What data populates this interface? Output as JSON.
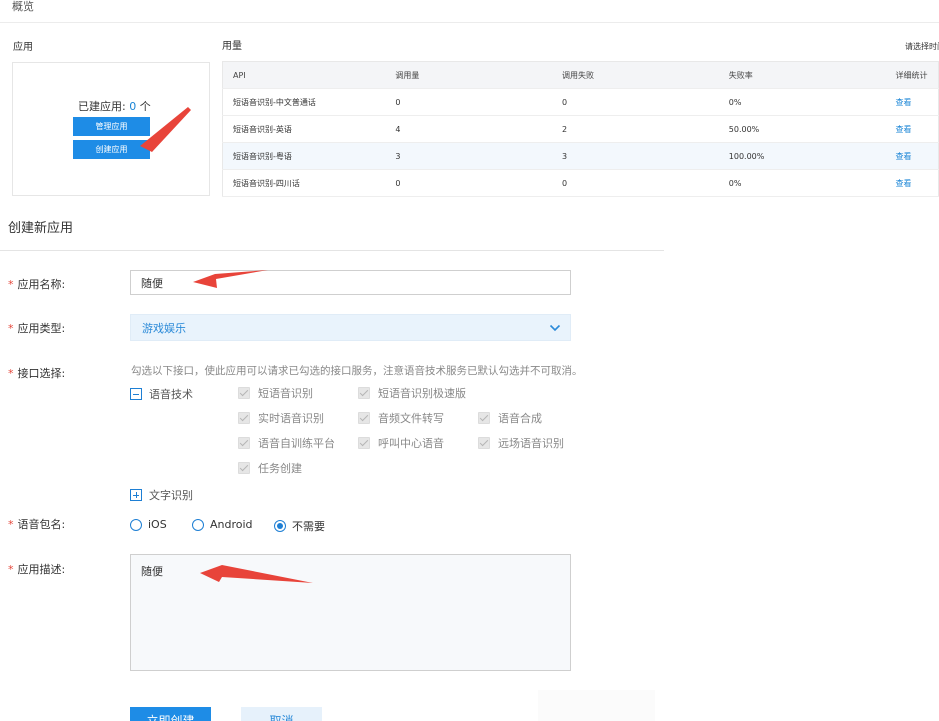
{
  "overview": {
    "title": "概览",
    "apps_label": "应用",
    "usage_label": "用量",
    "select_time": "请选择时间",
    "app_count_prefix": "已建应用: ",
    "app_count": "0",
    "app_count_suffix": " 个",
    "manage_button": "管理应用",
    "create_button": "创建应用"
  },
  "usage_table": {
    "headers": [
      "API",
      "调用量",
      "调用失败",
      "失败率",
      "详细统计"
    ],
    "rows": [
      {
        "api": "短语音识别-中文普通话",
        "calls": "0",
        "failures": "0",
        "rate": "0%",
        "detail": "查看"
      },
      {
        "api": "短语音识别-英语",
        "calls": "4",
        "failures": "2",
        "rate": "50.00%",
        "detail": "查看"
      },
      {
        "api": "短语音识别-粤语",
        "calls": "3",
        "failures": "3",
        "rate": "100.00%",
        "detail": "查看"
      },
      {
        "api": "短语音识别-四川话",
        "calls": "0",
        "failures": "0",
        "rate": "0%",
        "detail": "查看"
      }
    ]
  },
  "form": {
    "title": "创建新应用",
    "required_mark": "*",
    "name_label": "应用名称:",
    "name_value": "随便",
    "type_label": "应用类型:",
    "type_value": "游戏娱乐",
    "api_label": "接口选择:",
    "api_hint": "勾选以下接口，使此应用可以请求已勾选的接口服务，注意语音技术服务已默认勾选并不可取消。",
    "speech_group": "语音技术",
    "speech_items": [
      "短语音识别",
      "短语音识别极速版",
      "实时语音识别",
      "音频文件转写",
      "语音合成",
      "语音自训练平台",
      "呼叫中心语音",
      "远场语音识别",
      "任务创建"
    ],
    "ocr_group": "文字识别",
    "package_label": "语音包名:",
    "package_options": [
      "iOS",
      "Android",
      "不需要"
    ],
    "package_selected": "不需要",
    "desc_label": "应用描述:",
    "desc_value": "随便",
    "submit_button": "立即创建",
    "cancel_button": "取消"
  },
  "colors": {
    "accent": "#1e8ce6",
    "link": "#1a85d6",
    "required": "#e5463a",
    "annotation_arrow": "#e8443a"
  }
}
